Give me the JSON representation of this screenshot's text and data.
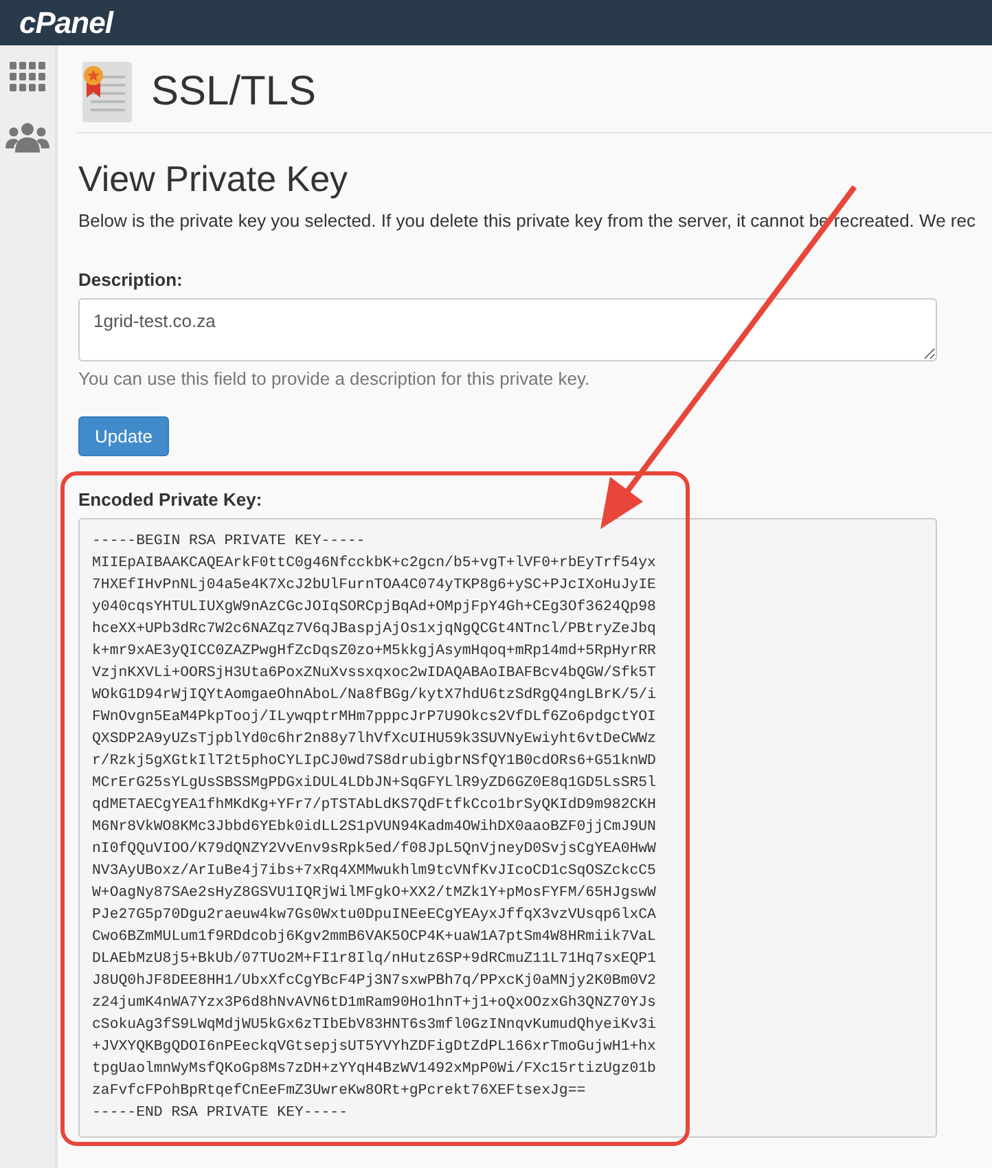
{
  "header": {
    "logo": "cPanel"
  },
  "sidebar": {
    "items": [
      {
        "kind": "grid"
      },
      {
        "kind": "users"
      }
    ]
  },
  "page": {
    "title": "SSL/TLS",
    "heading": "View Private Key",
    "intro": "Below is the private key you selected. If you delete this private key from the server, it cannot be recreated. We rec"
  },
  "description": {
    "label": "Description:",
    "value": "1grid-test.co.za",
    "help": "You can use this field to provide a description for this private key."
  },
  "buttons": [
    "Update"
  ],
  "private_key": {
    "label": "Encoded Private Key:",
    "lines": [
      "-----BEGIN RSA PRIVATE KEY-----",
      "MIIEpAIBAAKCAQEArkF0ttC0g46NfcckbK+c2gcn/b5+vgT+lVF0+rbEyTrf54yx",
      "7HXEfIHvPnNLj04a5e4K7XcJ2bUlFurnTOA4C074yTKP8g6+ySC+PJcIXoHuJyIE",
      "y040cqsYHTULIUXgW9nAzCGcJOIqSORCpjBqAd+OMpjFpY4Gh+CEg3Of3624Qp98",
      "hceXX+UPb3dRc7W2c6NAZqz7V6qJBaspjAjOs1xjqNgQCGt4NTncl/PBtryZeJbq",
      "k+mr9xAE3yQICC0ZAZPwgHfZcDqsZ0zo+M5kkgjAsymHqoq+mRp14md+5RpHyrRR",
      "VzjnKXVLi+OORSjH3Uta6PoxZNuXvssxqxoc2wIDAQABAoIBAFBcv4bQGW/Sfk5T",
      "WOkG1D94rWjIQYtAomgaeOhnAboL/Na8fBGg/kytX7hdU6tzSdRgQ4ngLBrK/5/i",
      "FWnOvgn5EaM4PkpTooj/ILywqptrMHm7pppcJrP7U9Okcs2VfDLf6Zo6pdgctYOI",
      "QXSDP2A9yUZsTjpblYd0c6hr2n88y7lhVfXcUIHU59k3SUVNyEwiyht6vtDeCWWz",
      "r/Rzkj5gXGtkIlT2t5phoCYLIpCJ0wd7S8drubigbrNSfQY1B0cdORs6+G51knWD",
      "MCrErG25sYLgUsSBSSMgPDGxiDUL4LDbJN+SqGFYLlR9yZD6GZ0E8q1GD5LsSR5l",
      "qdMETAECgYEA1fhMKdKg+YFr7/pTSTAbLdKS7QdFtfkCco1brSyQKIdD9m982CKH",
      "M6Nr8VkWO8KMc3Jbbd6YEbk0idLL2S1pVUN94Kadm4OWihDX0aaoBZF0jjCmJ9UN",
      "nI0fQQuVIOO/K79dQNZY2VvEnv9sRpk5ed/f08JpL5QnVjneyD0SvjsCgYEA0HwW",
      "NV3AyUBoxz/ArIuBe4j7ibs+7xRq4XMMwukhlm9tcVNfKvJIcoCD1cSqOSZckcC5",
      "W+OagNy87SAe2sHyZ8GSVU1IQRjWilMFgkO+XX2/tMZk1Y+pMosFYFM/65HJgswW",
      "PJe27G5p70Dgu2raeuw4kw7Gs0Wxtu0DpuINEeECgYEAyxJffqX3vzVUsqp6lxCA",
      "Cwo6BZmMULum1f9RDdcobj6Kgv2mmB6VAK5OCP4K+uaW1A7ptSm4W8HRmiik7VaL",
      "DLAEbMzU8j5+BkUb/07TUo2M+FI1r8Ilq/nHutz6SP+9dRCmuZ11L71Hq7sxEQP1",
      "J8UQ0hJF8DEE8HH1/UbxXfcCgYBcF4Pj3N7sxwPBh7q/PPxcKj0aMNjy2K0Bm0V2",
      "z24jumK4nWA7Yzx3P6d8hNvAVN6tD1mRam90Ho1hnT+j1+oQxOOzxGh3QNZ70YJs",
      "cSokuAg3fS9LWqMdjWU5kGx6zTIbEbV83HNT6s3mfl0GzINnqvKumudQhyeiKv3i",
      "+JVXYQKBgQDOI6nPEeckqVGtsepjsUT5YVYhZDFigDtZdPL166xrTmoGujwH1+hx",
      "tpgUaolmnWyMsfQKoGp8Ms7zDH+zYYqH4BzWV1492xMpP0Wi/FXc15rtizUgz01b",
      "zaFvfcFPohBpRtqefCnEeFmZ3UwreKw8ORt+gPcrekt76XEFtsexJg==",
      "-----END RSA PRIVATE KEY-----"
    ]
  }
}
